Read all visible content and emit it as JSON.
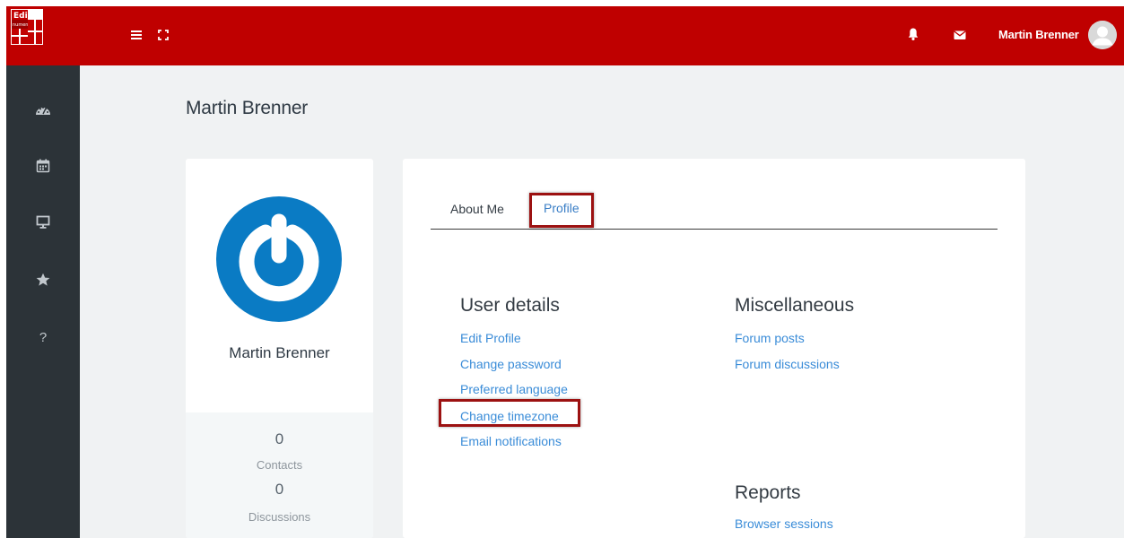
{
  "header": {
    "logo_text": "Edi numen",
    "user_name": "Martin Brenner",
    "brand_color": "#bf0000",
    "icons": [
      "menu-icon",
      "fullscreen-icon",
      "bell-icon",
      "mail-icon",
      "user-avatar-icon"
    ]
  },
  "sidebar": {
    "items": [
      {
        "icon": "dashboard-icon"
      },
      {
        "icon": "calendar-icon"
      },
      {
        "icon": "monitor-icon"
      },
      {
        "icon": "star-icon"
      },
      {
        "icon": "help-icon",
        "glyph": "?"
      }
    ]
  },
  "page": {
    "title": "Martin Brenner"
  },
  "profile_card": {
    "name": "Martin Brenner",
    "stats": {
      "contacts_value": "0",
      "contacts_label": "Contacts",
      "discussions_value": "0",
      "discussions_label": "Discussions"
    }
  },
  "tabs": [
    {
      "label": "About Me",
      "active": false
    },
    {
      "label": "Profile",
      "active": true
    }
  ],
  "sections": {
    "user_details": {
      "heading": "User details",
      "links": [
        "Edit Profile",
        "Change password",
        "Preferred language",
        "Change timezone",
        "Email notifications"
      ]
    },
    "miscellaneous": {
      "heading": "Miscellaneous",
      "links": [
        "Forum posts",
        "Forum discussions"
      ]
    },
    "reports": {
      "heading": "Reports",
      "links": [
        "Browser sessions"
      ]
    }
  },
  "colors": {
    "sidebar_bg": "#2c3338",
    "link": "#3a8cd8",
    "highlight_border": "#9c1111",
    "avatar_blue": "#0a7bc4"
  }
}
